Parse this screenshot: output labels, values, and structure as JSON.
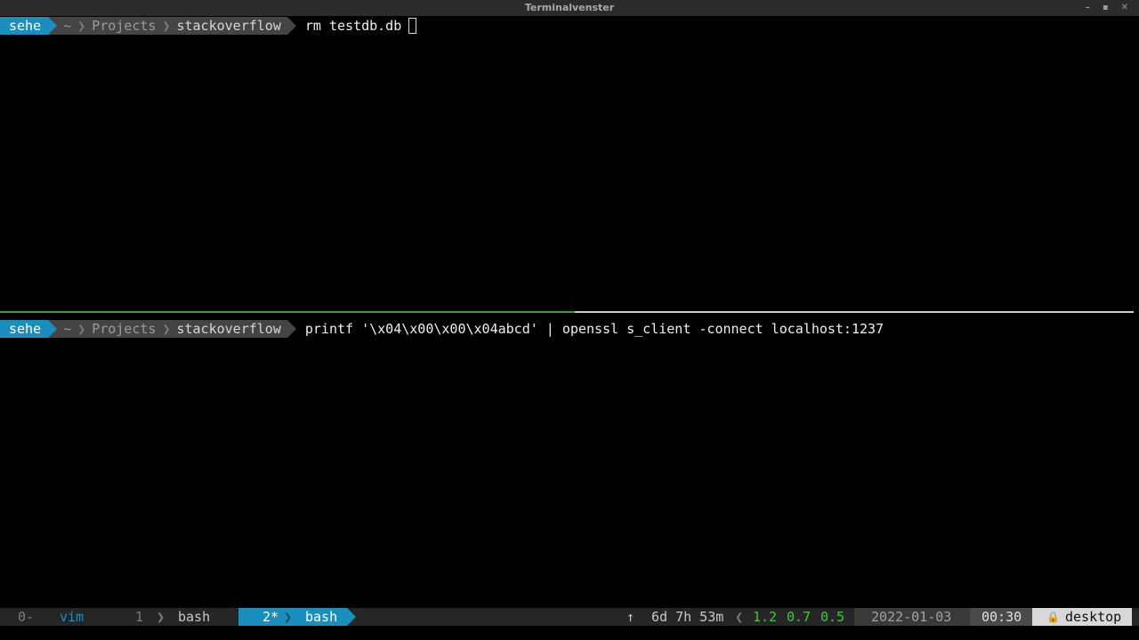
{
  "window": {
    "title": "Terminalvenster",
    "controls": [
      "–",
      "▪",
      "✕"
    ]
  },
  "top_pane": {
    "prompt": {
      "user": "sehe",
      "home": "~",
      "dir1": "Projects",
      "dir2": "stackoverflow"
    },
    "command": "rm testdb.db"
  },
  "bottom_pane": {
    "prompt": {
      "user": "sehe",
      "home": "~",
      "dir1": "Projects",
      "dir2": "stackoverflow"
    },
    "command": "printf '\\x04\\x00\\x00\\x04abcd' | openssl s_client -connect localhost:1237"
  },
  "statusbar": {
    "windows": [
      {
        "index": "0-",
        "name": "vim"
      },
      {
        "index": "1",
        "name": "bash"
      },
      {
        "index": "2*",
        "name": "bash",
        "active": true
      }
    ],
    "uptime_arrow": "↑",
    "uptime": "6d 7h 53m",
    "load": [
      "1.2",
      "0.7",
      "0.5"
    ],
    "date": "2022-01-03",
    "time": "00:30",
    "host": "desktop",
    "lock_icon": "🔒",
    "colors": {
      "accent": "#1a8fbd",
      "load_green": "#3fc63f",
      "pane_divider_active": "#3a9a3a"
    }
  }
}
